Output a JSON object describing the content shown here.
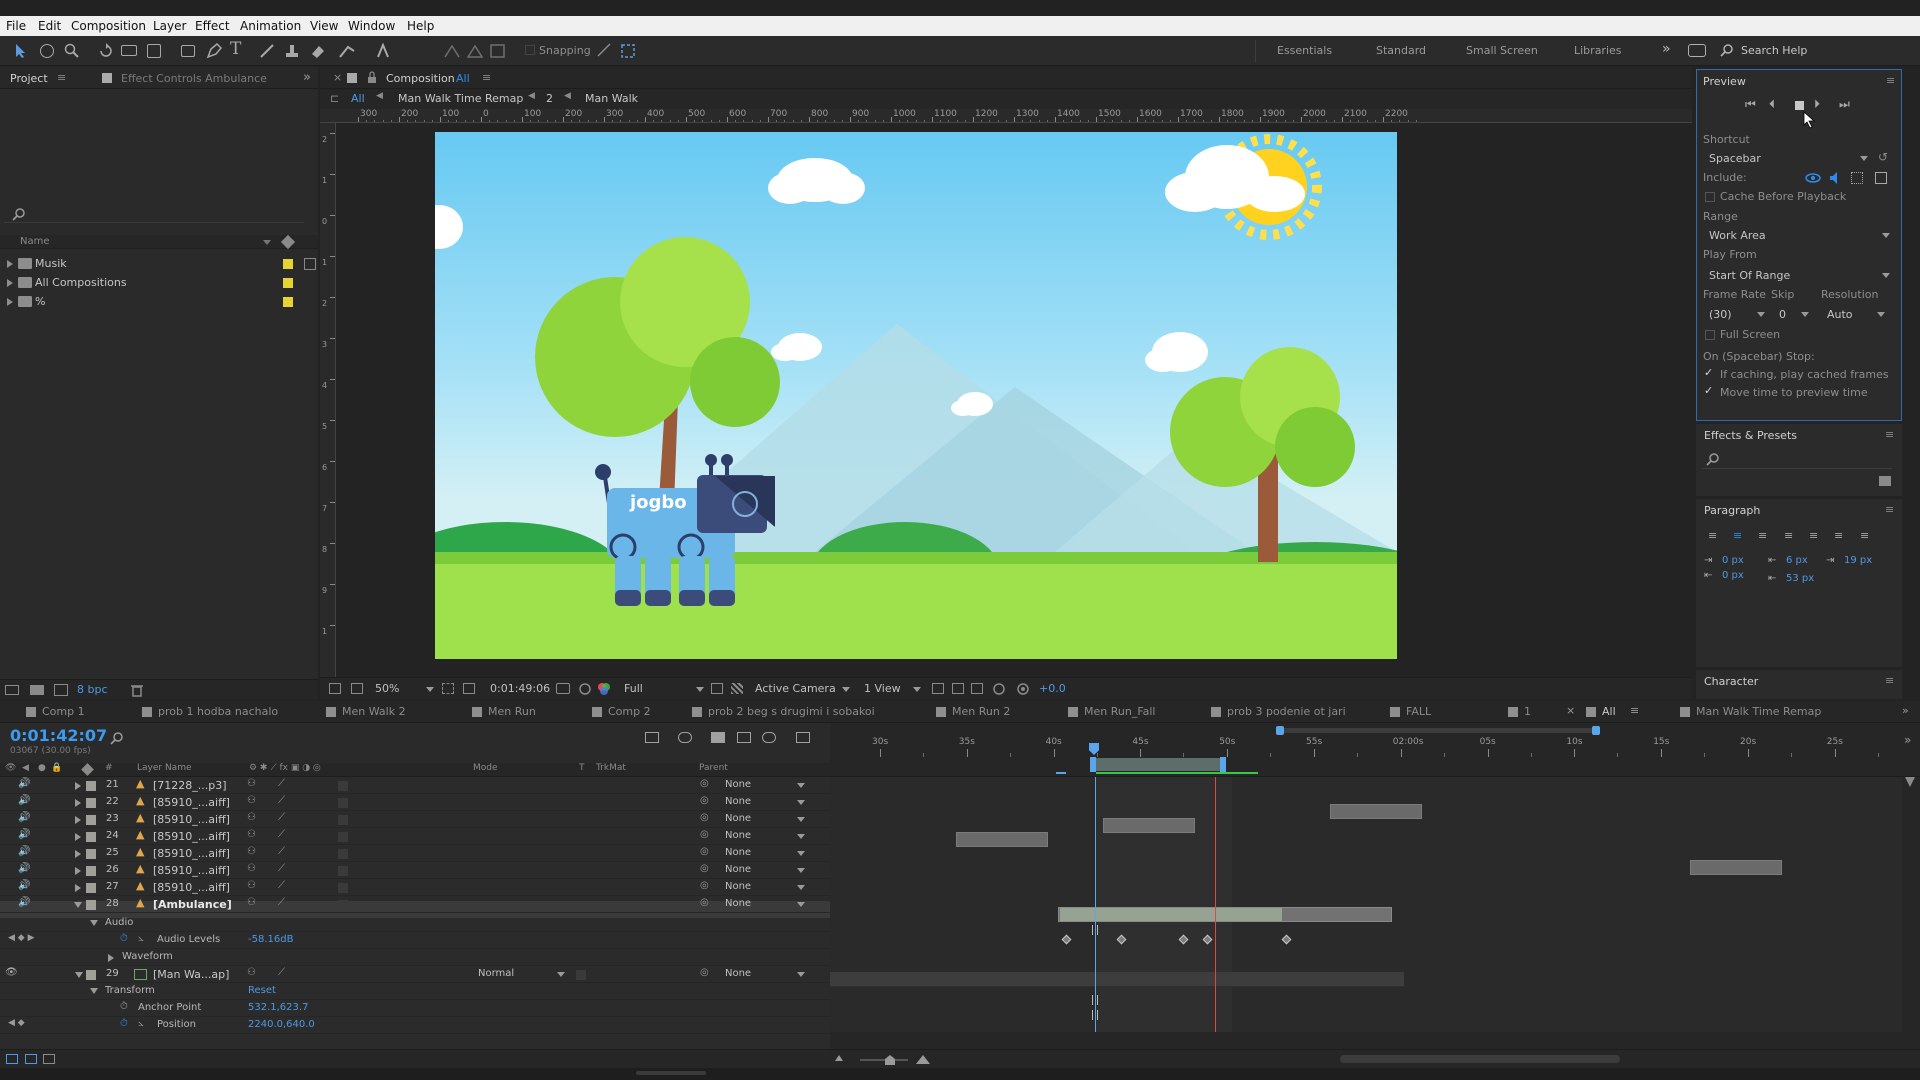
{
  "menu": [
    "File",
    "Edit",
    "Composition",
    "Layer",
    "Effect",
    "Animation",
    "View",
    "Window",
    "Help"
  ],
  "toolbar": {
    "snapping": "Snapping",
    "workspaces": [
      "Essentials",
      "Standard",
      "Small Screen",
      "Libraries"
    ],
    "search": "Search Help"
  },
  "project": {
    "tab": "Project",
    "effect_tab": "Effect Controls Ambulance",
    "col_name": "Name",
    "items": [
      {
        "name": "Musik",
        "color": "#e6d435"
      },
      {
        "name": "All Compositions",
        "color": "#e6d435"
      },
      {
        "name": "%",
        "color": "#e6d435"
      }
    ],
    "bpc": "8 bpc"
  },
  "comp": {
    "tab_prefix": "Composition",
    "tab_name": "All",
    "crumbs": [
      "All",
      "Man Walk Time Remap",
      "2",
      "Man Walk"
    ],
    "ruler": [
      "300",
      "200",
      "100",
      "0",
      "100",
      "200",
      "300",
      "400",
      "500",
      "600",
      "700",
      "800",
      "900",
      "1000",
      "1100",
      "1200",
      "1300",
      "1400",
      "1500",
      "1600",
      "1700",
      "1800",
      "1900",
      "2000",
      "2100",
      "2200"
    ],
    "vruler": [
      "2",
      "1",
      "0",
      "1",
      "2",
      "3",
      "4",
      "5",
      "6",
      "7",
      "8",
      "9",
      "1"
    ],
    "scene_label": "jogbo",
    "footer": {
      "zoom": "50%",
      "time": "0:01:49:06",
      "res": "Full",
      "camera": "Active Camera",
      "views": "1 View",
      "exposure": "+0.0"
    }
  },
  "preview": {
    "title": "Preview",
    "shortcut_label": "Shortcut",
    "shortcut": "Spacebar",
    "include": "Include:",
    "cache": "Cache Before Playback",
    "range_label": "Range",
    "range": "Work Area",
    "playfrom_label": "Play From",
    "playfrom": "Start Of Range",
    "fr_label": "Frame Rate",
    "skip_label": "Skip",
    "res_label": "Resolution",
    "fr": "(30)",
    "skip": "0",
    "res": "Auto",
    "fullscreen": "Full Screen",
    "stop_label": "On (Spacebar) Stop:",
    "opt1": "If caching, play cached frames",
    "opt2": "Move time to preview time"
  },
  "effects": {
    "title": "Effects & Presets"
  },
  "paragraph": {
    "title": "Paragraph",
    "v1": "0 px",
    "v2": "6 px",
    "v3": "19 px",
    "v4": "0 px",
    "v5": "53 px"
  },
  "character": {
    "title": "Character"
  },
  "timeline": {
    "tabs": [
      {
        "label": "Comp 1",
        "color": "#8f8f8f"
      },
      {
        "label": "prob 1 hodba nachalo",
        "color": "#8f8f8f"
      },
      {
        "label": "Men Walk 2",
        "color": "#8f8f8f"
      },
      {
        "label": "Men Run",
        "color": "#8f8f8f"
      },
      {
        "label": "Comp 2",
        "color": "#8f8f8f"
      },
      {
        "label": "prob 2 beg s drugimi i sobakoi",
        "color": "#8f8f8f"
      },
      {
        "label": "Men Run 2",
        "color": "#8f8f8f"
      },
      {
        "label": "Men Run_Fall",
        "color": "#8f8f8f"
      },
      {
        "label": "prob 3 podenie ot jari",
        "color": "#8f8f8f"
      },
      {
        "label": "FALL",
        "color": "#8f8f8f"
      },
      {
        "label": "1",
        "color": "#8f8f8f"
      },
      {
        "label": "All",
        "color": "#8f8f8f"
      },
      {
        "label": "Man Walk Time Remap",
        "color": "#8f8f8f"
      }
    ],
    "timecode": "0:01:42:07",
    "fps": "03067 (30.00 fps)",
    "cols": {
      "name": "Layer Name",
      "mode": "Mode",
      "t": "T",
      "trkmat": "TrkMat",
      "parent": "Parent"
    },
    "ticks": [
      "30s",
      "35s",
      "40s",
      "45s",
      "50s",
      "55s",
      "02:00s",
      "05s",
      "10s",
      "15s",
      "20s",
      "25s"
    ],
    "layers": [
      {
        "num": "21",
        "name": "[71228_...p3]",
        "parent": "None"
      },
      {
        "num": "22",
        "name": "[85910_...aiff]",
        "parent": "None"
      },
      {
        "num": "23",
        "name": "[85910_...aiff]",
        "parent": "None"
      },
      {
        "num": "24",
        "name": "[85910_...aiff]",
        "parent": "None"
      },
      {
        "num": "25",
        "name": "[85910_...aiff]",
        "parent": "None"
      },
      {
        "num": "26",
        "name": "[85910_...aiff]",
        "parent": "None"
      },
      {
        "num": "27",
        "name": "[85910_...aiff]",
        "parent": "None"
      },
      {
        "num": "28",
        "name": "[Ambulance]",
        "parent": "None"
      }
    ],
    "audio": "Audio",
    "audio_levels": "Audio Levels",
    "audio_value": "-58.16dB",
    "waveform": "Waveform",
    "layer29": {
      "num": "29",
      "name": "[Man Wa...ap]",
      "mode": "Normal",
      "parent": "None"
    },
    "transform": "Transform",
    "reset": "Reset",
    "anchor": "Anchor Point",
    "anchor_value": "532.1,623.7",
    "position": "Position",
    "position_value": "2240.0,640.0"
  }
}
